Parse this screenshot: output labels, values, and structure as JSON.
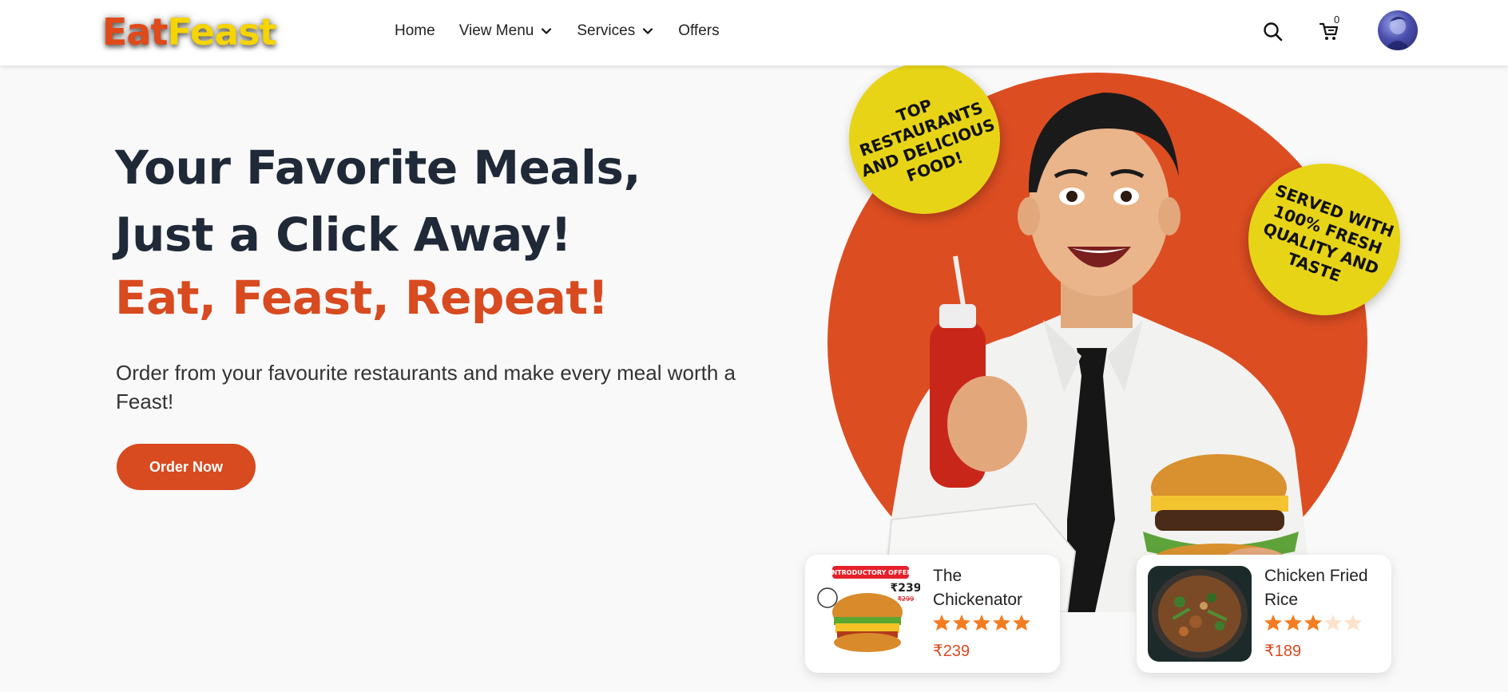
{
  "brand": {
    "part1": "Eat",
    "part2": "Feast"
  },
  "nav": {
    "items": [
      {
        "label": "Home",
        "has_dropdown": false
      },
      {
        "label": "View Menu",
        "has_dropdown": true
      },
      {
        "label": "Services",
        "has_dropdown": true
      },
      {
        "label": "Offers",
        "has_dropdown": false
      }
    ],
    "cart_count": "0",
    "icons": [
      "search-icon",
      "cart-icon",
      "avatar"
    ]
  },
  "hero": {
    "title_line1": "Your Favorite Meals,",
    "title_line2": "Just a Click Away!",
    "accent": "Eat, Feast, Repeat!",
    "subtitle": "Order from your favourite restaurants and make every meal worth a Feast!",
    "cta_label": "Order Now"
  },
  "badges": {
    "left": "TOP RESTAURANTS AND DELICIOUS FOOD!",
    "right": "SERVED WITH 100% FRESH QUALITY AND TASTE"
  },
  "products": [
    {
      "name": "The Chickenator",
      "rating": 5,
      "max_rating": 5,
      "price": "₹239",
      "image_text": {
        "offer": "INTRODUCTORY OFFER",
        "price": "₹239",
        "old_price": "₹299"
      }
    },
    {
      "name": "Chicken Fried Rice",
      "rating": 3,
      "max_rating": 5,
      "price": "₹189"
    }
  ],
  "colors": {
    "accent": "#d84a1f",
    "circle": "#dd4d22",
    "badge": "#e8d417",
    "star": "#f47c20",
    "star_empty": "#fde2cc"
  }
}
